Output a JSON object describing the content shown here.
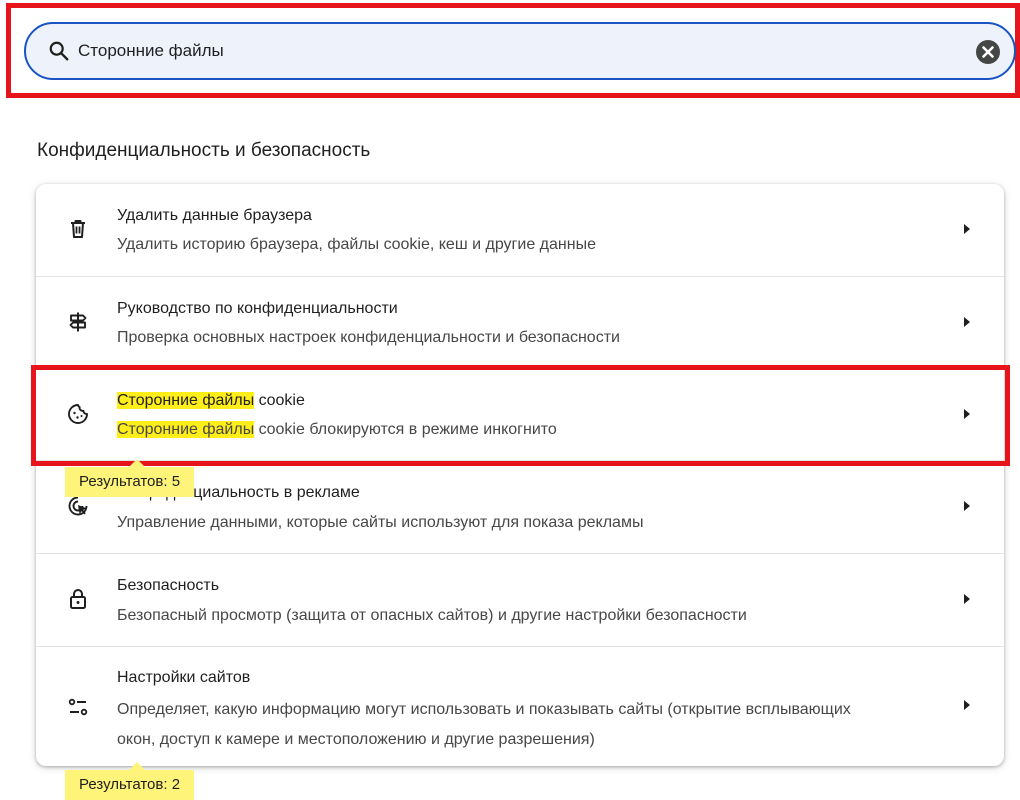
{
  "search": {
    "value": "Сторонние файлы",
    "clear_label": "×"
  },
  "section": {
    "title": "Конфиденциальность и безопасность"
  },
  "rows": [
    {
      "icon": "trash-icon",
      "title": "Удалить данные браузера",
      "subtitle": "Удалить историю браузера, файлы cookie, кеш и другие данные"
    },
    {
      "icon": "signpost-icon",
      "title": "Руководство по конфиденциальности",
      "subtitle": "Проверка основных настроек конфиденциальности и безопасности"
    },
    {
      "icon": "cookie-icon",
      "title_highlight": "Сторонние файлы",
      "title_rest": " cookie",
      "subtitle_highlight": "Сторонние файлы",
      "subtitle_rest": " cookie блокируются в режиме инкогнито"
    },
    {
      "icon": "ad-privacy-icon",
      "title": "Конфиденциальность в рекламе",
      "subtitle": "Управление данными, которые сайты используют для показа рекламы"
    },
    {
      "icon": "lock-icon",
      "title": "Безопасность",
      "subtitle": "Безопасный просмотр (защита от опасных сайтов) и другие настройки безопасности"
    },
    {
      "icon": "site-settings-icon",
      "title": "Настройки сайтов",
      "subtitle": "Определяет, какую информацию могут использовать и показывать сайты (открытие всплывающих окон, доступ к камере и местоположению и другие разрешения)"
    }
  ],
  "bubbles": {
    "cookie_results": "Результатов: 5",
    "site_results": "Результатов: 2"
  },
  "colors": {
    "search_border": "#1a53c4",
    "highlight": "#ffee1a",
    "annotation_frame": "#e8141b"
  }
}
